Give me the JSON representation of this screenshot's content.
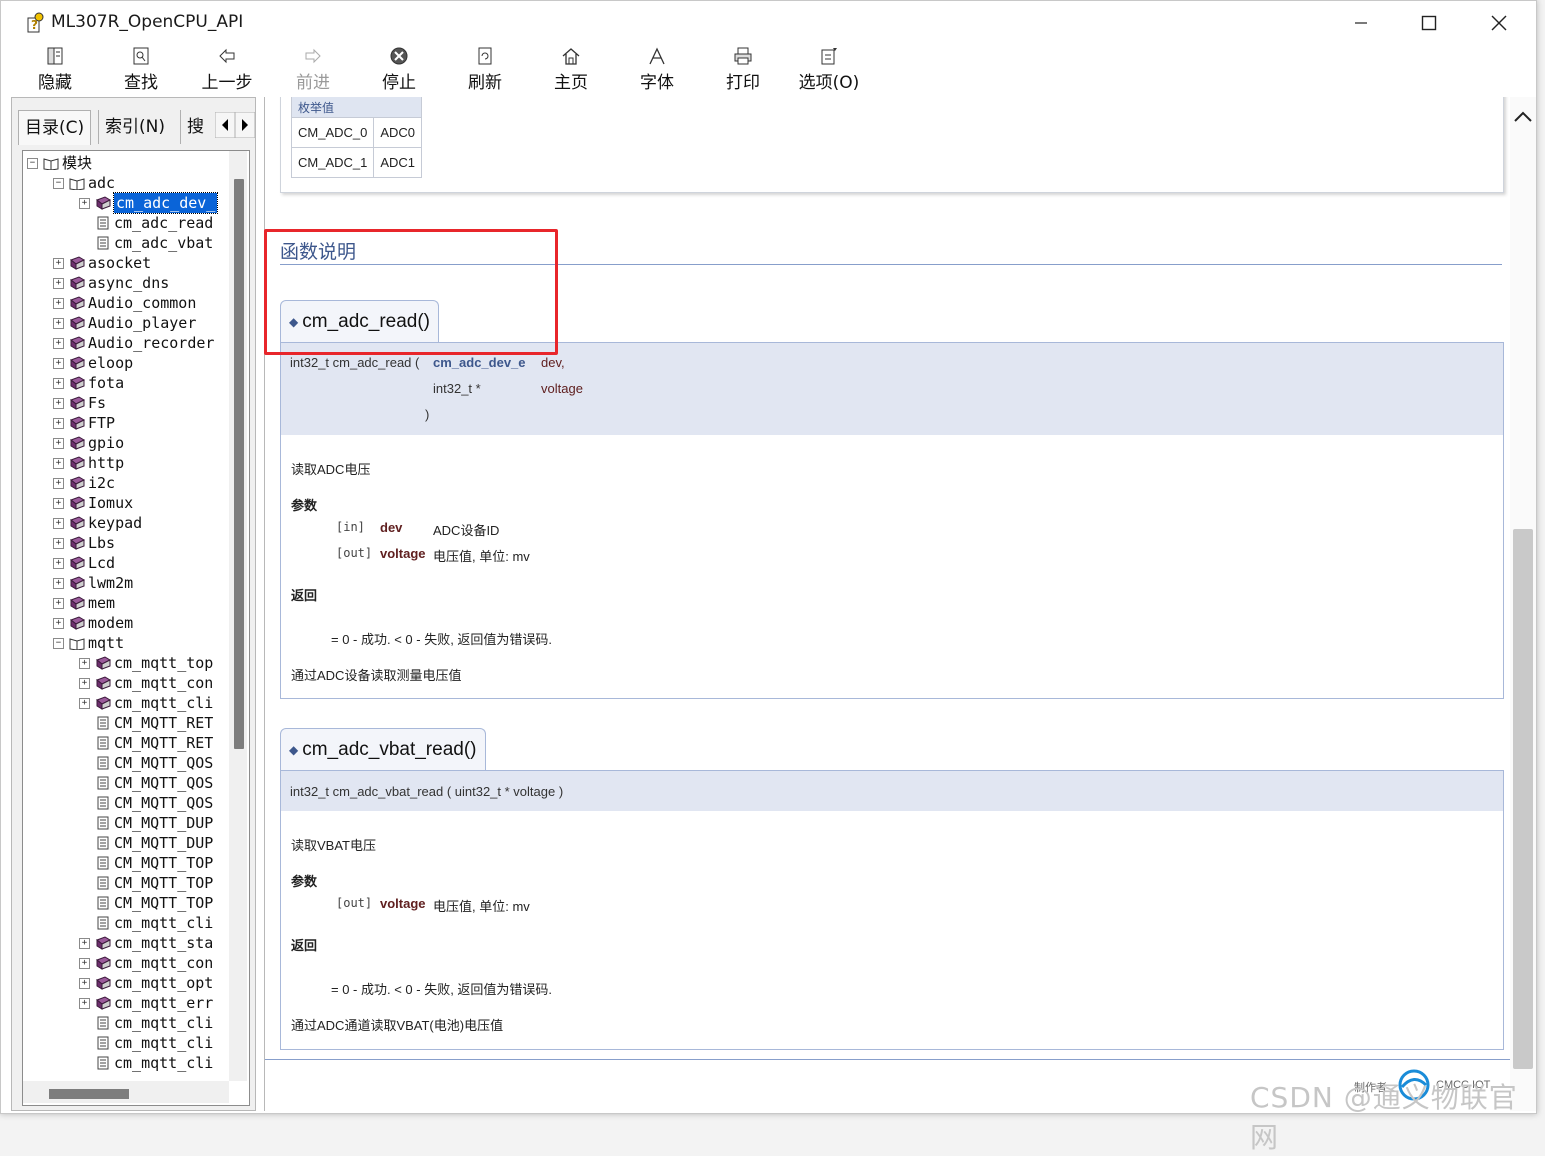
{
  "window": {
    "title": "ML307R_OpenCPU_API"
  },
  "toolbar": {
    "hide": "隐藏",
    "find": "查找",
    "back": "上一步",
    "forward": "前进",
    "stop": "停止",
    "refresh": "刷新",
    "home": "主页",
    "font": "字体",
    "print": "打印",
    "options": "选项(O)"
  },
  "nav_tabs": {
    "contents": "目录(C)",
    "index": "索引(N)",
    "search": "搜"
  },
  "tree": {
    "root": "模块",
    "adc": "adc",
    "adc_children": [
      "cm_adc_dev_",
      "cm_adc_read",
      "cm_adc_vbat"
    ],
    "modules": [
      "asocket",
      "async_dns",
      "Audio_common",
      "Audio_player",
      "Audio_recorder",
      "eloop",
      "fota",
      "Fs",
      "FTP",
      "gpio",
      "http",
      "i2c",
      "Iomux",
      "keypad",
      "Lbs",
      "Lcd",
      "lwm2m",
      "mem",
      "modem"
    ],
    "mqtt": "mqtt",
    "mqtt_children": [
      "cm_mqtt_top",
      "cm_mqtt_con",
      "cm_mqtt_cli",
      "CM_MQTT_RET",
      "CM_MQTT_RET",
      "CM_MQTT_QOS",
      "CM_MQTT_QOS",
      "CM_MQTT_QOS",
      "CM_MQTT_DUP",
      "CM_MQTT_DUP",
      "CM_MQTT_TOP",
      "CM_MQTT_TOP",
      "CM_MQTT_TOP",
      "cm_mqtt_cli",
      "cm_mqtt_sta",
      "cm_mqtt_con",
      "cm_mqtt_opt",
      "cm_mqtt_err",
      "cm_mqtt_cli",
      "cm_mqtt_cli",
      "cm_mqtt_cli"
    ]
  },
  "enum_table": {
    "header": "枚举值",
    "rows": [
      [
        "CM_ADC_0",
        "ADC0"
      ],
      [
        "CM_ADC_1",
        "ADC1"
      ]
    ]
  },
  "section_title": "函数说明",
  "func1": {
    "name": "cm_adc_read()",
    "proto_ret": "int32_t cm_adc_read (",
    "p1_type": "cm_adc_dev_e",
    "p1_name": "dev,",
    "p2_type": "int32_t *",
    "p2_name": "voltage",
    "close": ")",
    "brief": "读取ADC电压",
    "params_label": "参数",
    "param1_dir": "[in]",
    "param1_name": "dev",
    "param1_desc": "ADC设备ID",
    "param2_dir": "[out]",
    "param2_name": "voltage",
    "param2_desc": "电压值, 单位: mv",
    "return_label": "返回",
    "return_text": "= 0 - 成功. < 0 - 失败, 返回值为错误码.",
    "detail": "通过ADC设备读取测量电压值"
  },
  "func2": {
    "name": "cm_adc_vbat_read()",
    "proto": "int32_t cm_adc_vbat_read ( uint32_t *  voltage )",
    "brief": "读取VBAT电压",
    "params_label": "参数",
    "param1_dir": "[out]",
    "param1_name": "voltage",
    "param1_desc": "电压值, 单位: mv",
    "return_label": "返回",
    "return_text": "= 0 - 成功. < 0 - 失败, 返回值为错误码.",
    "detail": "通过ADC通道读取VBAT(电池)电压值"
  },
  "footer": {
    "made_by": "制作者",
    "logo_text": "CMCC IOT"
  },
  "watermark": "CSDN @通义物联官网"
}
